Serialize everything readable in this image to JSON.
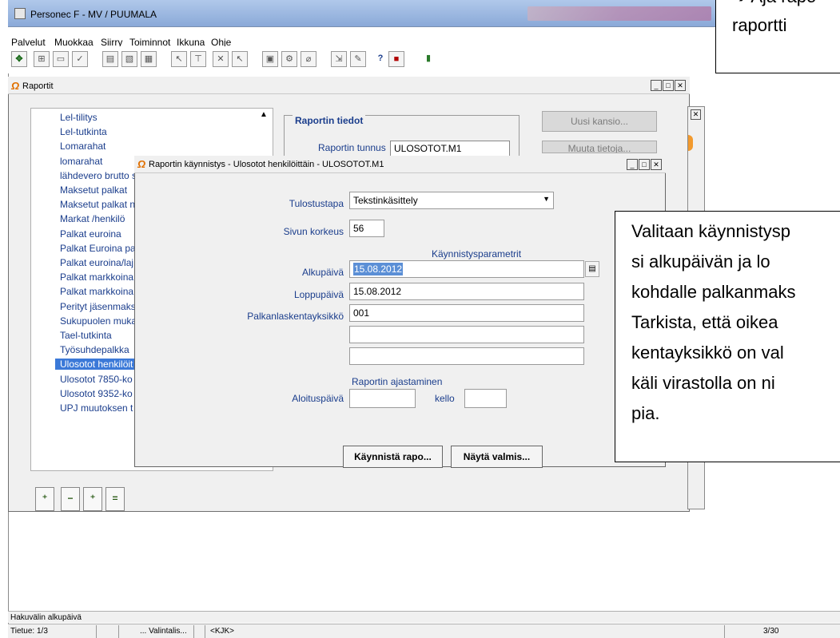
{
  "app": {
    "title": "Personec F - MV / PUUMALA",
    "menu": [
      "Palvelut",
      "Muokkaa",
      "Siirry",
      "Toiminnot",
      "Ikkuna",
      "Ohje"
    ]
  },
  "raportit": {
    "title": "Raportit",
    "list_items": [
      "Lel-tilitys",
      "Lel-tutkinta",
      "Lomarahat",
      "lomarahat",
      "lähdevero brutto s",
      "Maksetut palkat",
      "Maksetut palkat n",
      "Markat /henkilö",
      "Palkat euroina",
      "Palkat Euroina pa",
      "Palkat euroina/laj",
      "Palkat markkoina",
      "Palkat markkoina",
      "Perityt jäsenmaks",
      "Sukupuolen muka",
      "Tael-tutkinta",
      "Työsuhdepalkka",
      "Ulosotot henkilöit",
      "Ulosotot 7850-ko",
      "Ulosotot 9352-ko",
      "UPJ muutoksen t"
    ],
    "selected_index": 17,
    "tiedot_label": "Raportin tiedot",
    "tunnus_label": "Raportin tunnus",
    "tunnus_value": "ULOSOTOT.M1",
    "uusi_kansio": "Uusi kansio...",
    "muuta_tietoja": "Muuta tietoja..."
  },
  "dialog": {
    "title": "Raportin käynnistys - Ulosotot henkilöittäin - ULOSOTOT.M1",
    "tulostustapa_label": "Tulostustapa",
    "tulostustapa_value": "Tekstinkäsittely",
    "sivun_korkeus_label": "Sivun korkeus",
    "sivun_korkeus_value": "56",
    "parametrit_header": "Käynnistysparametrit",
    "alkupaiva_label": "Alkupäivä",
    "alkupaiva_value": "15.08.2012",
    "loppupaiva_label": "Loppupäivä",
    "loppupaiva_value": "15.08.2012",
    "yksikko_label": "Palkanlaskentayksikkö",
    "yksikko_value": "001",
    "ajastaminen_header": "Raportin ajastaminen",
    "aloituspaiva_label": "Aloituspäivä",
    "kello_label": "kello",
    "kaynnista_button": "Käynnistä rapo...",
    "nayta_button": "Näytä valmis..."
  },
  "callouts": {
    "top_line1": "➔ Aja rapo",
    "top_line2": "raportti",
    "main_lines": [
      "Valitaan käynnistysp",
      "si  alkupäivän  ja  lo",
      "kohdalle palkanmaks",
      "Tarkista,  että  oikea",
      "kentayksikkö  on  val",
      "käli  virastolla  on  ni",
      "pia."
    ]
  },
  "status": {
    "hint": "Hakuvälin alkupäivä",
    "tietue": "Tietue: 1/3",
    "valintalis": "... Valintalis...",
    "kjk": "<KJK>",
    "page": "3/30"
  }
}
